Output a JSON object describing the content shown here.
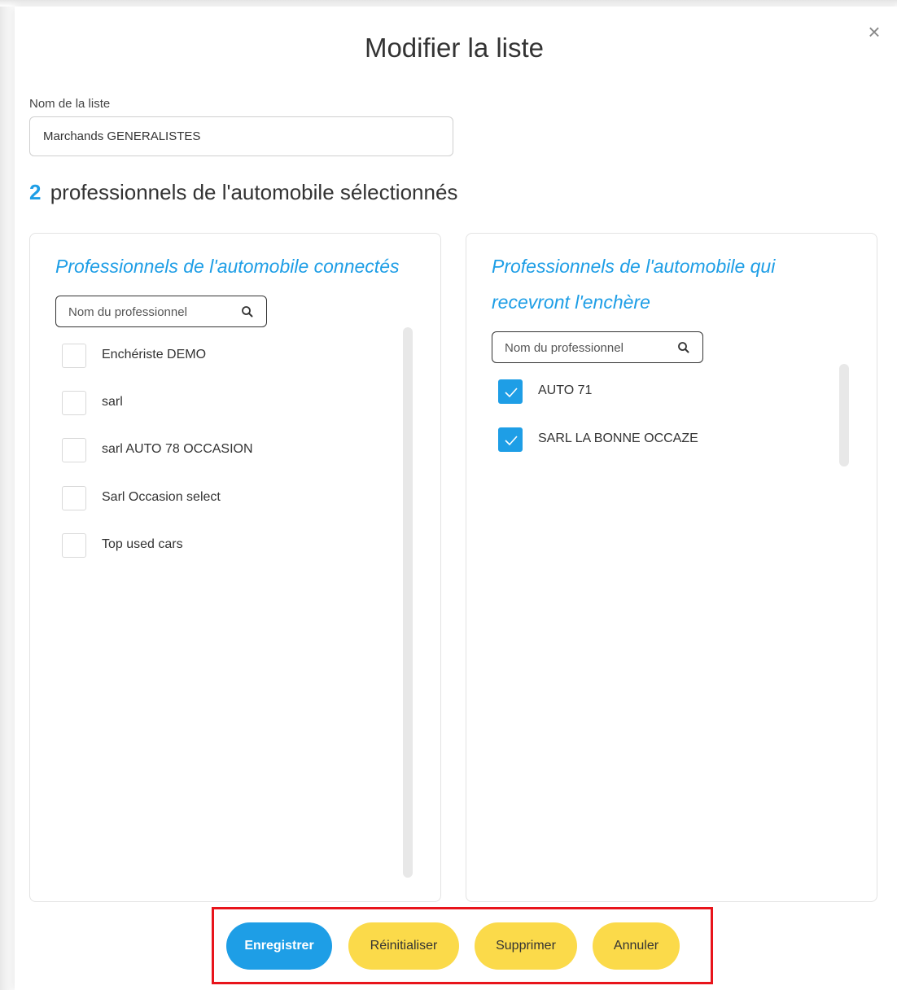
{
  "modal": {
    "title": "Modifier la liste",
    "close_glyph": "×"
  },
  "list_name": {
    "label": "Nom de la liste",
    "value": "Marchands GENERALISTES"
  },
  "selection_summary": {
    "count": "2",
    "text": "professionnels de l'automobile sélectionnés"
  },
  "left_panel": {
    "title": "Professionnels de l'automobile connectés",
    "search_placeholder": "Nom du professionnel",
    "items": [
      {
        "label": "Enchériste DEMO",
        "checked": false
      },
      {
        "label": "sarl",
        "checked": false
      },
      {
        "label": "sarl AUTO 78 OCCASION",
        "checked": false
      },
      {
        "label": "Sarl Occasion select",
        "checked": false
      },
      {
        "label": "Top used cars",
        "checked": false
      }
    ]
  },
  "right_panel": {
    "title_line1": "Professionnels de l'automobile qui",
    "title_line2": "recevront l'enchère",
    "search_placeholder": "Nom du professionnel",
    "items": [
      {
        "label": "AUTO 71",
        "checked": true
      },
      {
        "label": "SARL LA BONNE OCCAZE",
        "checked": true
      }
    ]
  },
  "actions": {
    "save_label": "Enregistrer",
    "reset_label": "Réinitialiser",
    "delete_label": "Supprimer",
    "cancel_label": "Annuler"
  },
  "colors": {
    "accent": "#1e9ee6",
    "button_yellow": "#fbda4a",
    "highlight_frame": "#e8141b"
  },
  "icons": {
    "close": "close-icon",
    "search": "search-icon",
    "check": "check-icon"
  }
}
